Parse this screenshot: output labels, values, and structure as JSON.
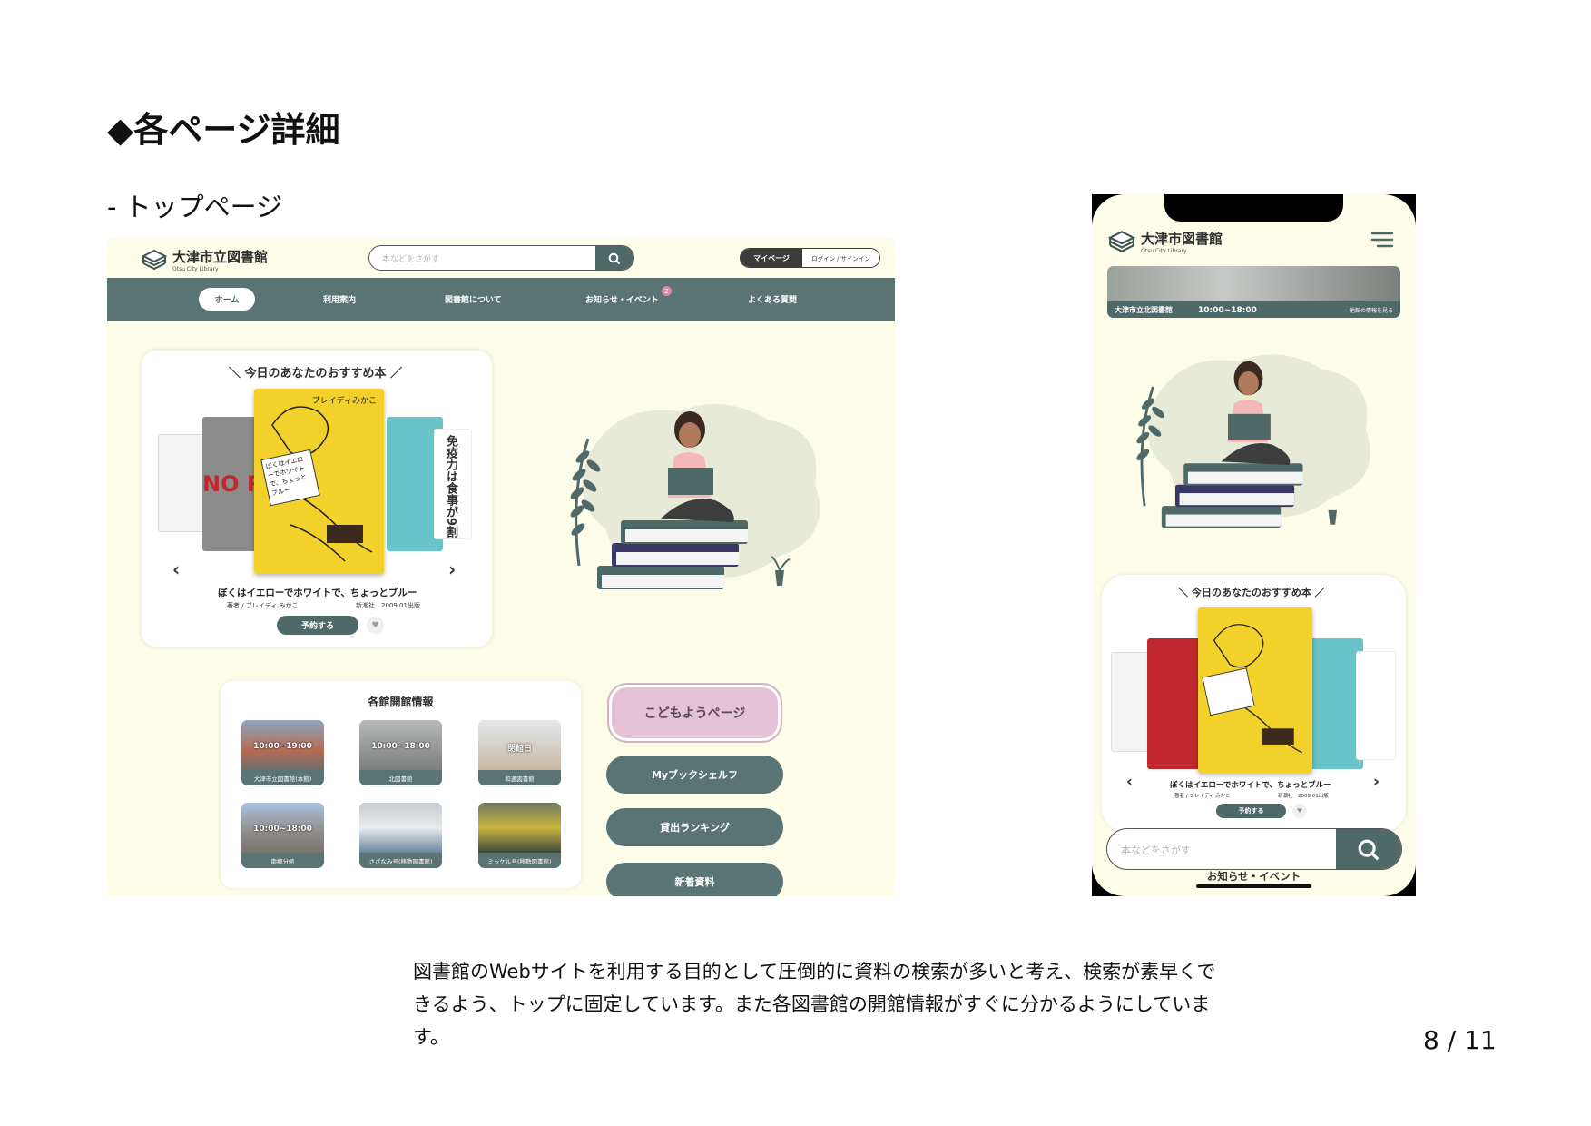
{
  "slide": {
    "title": "◆各ページ詳細",
    "section": "- トップページ",
    "description": "図書館のWebサイトを利用する目的として圧倒的に資料の検索が多いと考え、検索が素早くできるよう、トップに固定しています。また各図書館の開館情報がすぐに分かるようにしています。",
    "page_number": "8 / 11"
  },
  "desktop": {
    "logo": {
      "title": "大津市立図書館",
      "subtitle": "Otsu City Library"
    },
    "search": {
      "placeholder": "本などをさがす"
    },
    "auth": {
      "mypage": "マイページ",
      "login": "ログイン / サインイン"
    },
    "nav": {
      "items": [
        "ホーム",
        "利用案内",
        "図書館について",
        "お知らせ・イベント",
        "よくある質問"
      ],
      "badge": "2"
    },
    "recommend": {
      "heading": "今日のあなたのおすすめ本",
      "book_title": "ぼくはイエローでホワイトで、ちょっとブルー",
      "author": "著者 / ブレイディ みかこ",
      "publisher": "新潮社　2009.01出版",
      "reserve": "予約する",
      "center_cover": {
        "author": "ブレイディみかこ",
        "title": "ぼくはイエローでホワイトで、ちょっとブルー"
      },
      "side_cover_left": "NO RI",
      "side_cover_right": "免疫力は食事が9割"
    },
    "opening": {
      "heading": "各館開館情報",
      "tiles": [
        {
          "hours": "10:00~19:00",
          "name": "大津市立図書館(本館)"
        },
        {
          "hours": "10:00~18:00",
          "name": "北図書館"
        },
        {
          "hours": "閉館日",
          "name": "和邇図書館"
        },
        {
          "hours": "10:00~18:00",
          "name": "南郷分館"
        },
        {
          "hours": "",
          "name": "さざなみ号(移動図書館)"
        },
        {
          "hours": "",
          "name": "ミッケル号(移動図書館)"
        }
      ]
    },
    "side_buttons": [
      "こどもようページ",
      "Myブックシェルフ",
      "貸出ランキング",
      "新着資料"
    ]
  },
  "phone": {
    "logo": {
      "title": "大津市図書館",
      "subtitle": "Otsu City Library"
    },
    "banner": {
      "name": "大津市立北図書館",
      "hours": "10:00~18:00",
      "link": "他館の情報を見る"
    },
    "recommend": {
      "heading": "今日のあなたのおすすめ本",
      "book_title": "ぼくはイエローでホワイトで、ちょっとブルー",
      "author": "著者 / ブレイディ みかこ",
      "publisher": "新潮社　2009.01出版",
      "reserve": "予約する"
    },
    "search": {
      "placeholder": "本などをさがす"
    },
    "news_label": "お知らせ・イベント"
  },
  "colors": {
    "teal": "#5a7474",
    "cream": "#fcfce9",
    "pink": "#e4c3d7",
    "yellow": "#f2d12b",
    "book_navy": "#3a3866"
  },
  "icons": [
    "book-logo-icon",
    "search-icon",
    "menu-icon",
    "heart-icon",
    "chevron-left-icon",
    "chevron-right-icon"
  ]
}
